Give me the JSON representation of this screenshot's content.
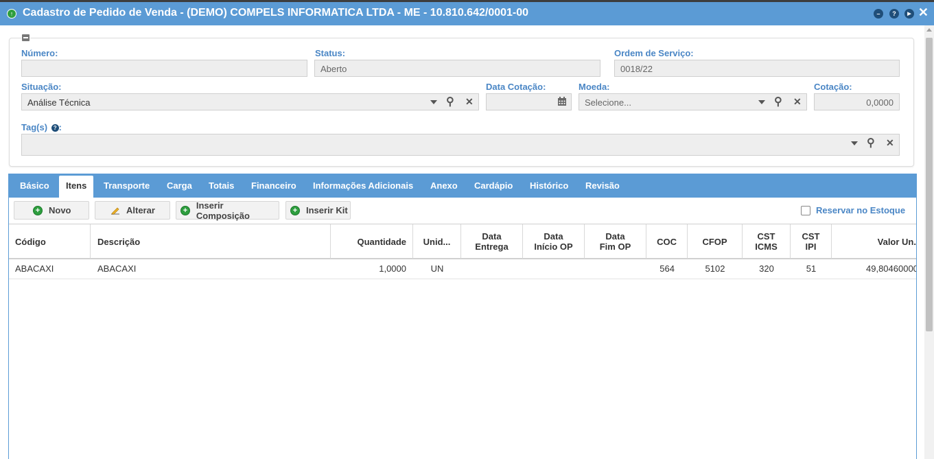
{
  "window": {
    "title": "Cadastro de Pedido de Venda - (DEMO) COMPELS INFORMATICA LTDA - ME - 10.810.642/0001-00",
    "title_icon": "arrow-up-circle-icon",
    "controls": [
      "minimize-icon",
      "help-icon",
      "next-icon",
      "close-icon"
    ],
    "control_glyphs": {
      "minimize": "–",
      "help": "?",
      "next": "▶",
      "close": "✕"
    }
  },
  "colors": {
    "accent": "#5b9bd5",
    "label": "#4a86c5",
    "ok_icon": "#2e9e3f"
  },
  "header": {
    "numero": {
      "label": "Número:",
      "value": ""
    },
    "status": {
      "label": "Status:",
      "value": "Aberto"
    },
    "ordem_servico": {
      "label": "Ordem de Serviço:",
      "value": "0018/22"
    },
    "situacao": {
      "label": "Situação:",
      "value": "Análise Técnica"
    },
    "data_cotacao": {
      "label": "Data Cotação:",
      "value": ""
    },
    "moeda": {
      "label": "Moeda:",
      "placeholder": "Selecione..."
    },
    "cotacao": {
      "label": "Cotação:",
      "value": "0,0000"
    },
    "tags": {
      "label": "Tag(s)",
      "value": ""
    }
  },
  "tabs": [
    "Básico",
    "Itens",
    "Transporte",
    "Carga",
    "Totais",
    "Financeiro",
    "Informações Adicionais",
    "Anexo",
    "Cardápio",
    "Histórico",
    "Revisão"
  ],
  "active_tab": "Itens",
  "toolbar": {
    "novo": "Novo",
    "alterar": "Alterar",
    "inserir_composicao": "Inserir Composição",
    "inserir_kit": "Inserir Kit",
    "reservar_estoque": "Reservar no Estoque",
    "reservar_checked": false
  },
  "grid": {
    "columns": [
      [
        "Código"
      ],
      [
        "Descrição"
      ],
      [
        "Quantidade"
      ],
      [
        "Unid..."
      ],
      [
        "Data",
        "Entrega"
      ],
      [
        "Data",
        "Início OP"
      ],
      [
        "Data",
        "Fim OP"
      ],
      [
        "COC"
      ],
      [
        "CFOP"
      ],
      [
        "CST",
        "ICMS"
      ],
      [
        "CST",
        "IPI"
      ],
      [
        "Valor Un."
      ]
    ],
    "rows": [
      {
        "codigo": "ABACAXI",
        "descricao": "ABACAXI",
        "quantidade": "1,0000",
        "unid": "UN",
        "data_entrega": "",
        "data_inicio_op": "",
        "data_fim_op": "",
        "coc": "564",
        "cfop": "5102",
        "cst_icms": "320",
        "cst_ipi": "51",
        "valor_un": "49,80460000"
      }
    ]
  }
}
